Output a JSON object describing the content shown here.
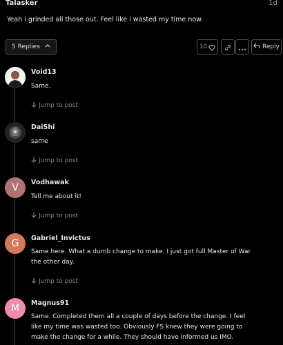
{
  "post": {
    "author": "Talasker",
    "age": "1d",
    "text": "Yeah i grinded all those out. Feel like i wasted my time now."
  },
  "actions": {
    "replies_label": "5 Replies",
    "like_count": "10",
    "reply_label": "Reply"
  },
  "jump_label": "Jump to post",
  "replies": [
    {
      "username": "Void13",
      "text": "Same.",
      "avatar_letter": "",
      "avatar_color": "#2a2a2a"
    },
    {
      "username": "DaiShi",
      "text": "same",
      "avatar_letter": "",
      "avatar_color": "#3a3a3a"
    },
    {
      "username": "Vodhawak",
      "text": "Tell me about it!",
      "avatar_letter": "V",
      "avatar_color": "#b07274"
    },
    {
      "username": "Gabriel_Invictus",
      "text": "Same here. What a dumb change to make. I just got full Master of War the other day.",
      "avatar_letter": "G",
      "avatar_color": "#d27a5b"
    },
    {
      "username": "Magnus91",
      "text": "Same. Completed them all a couple of days before the change. I feel like my time was wasted too. Obviously FS knew they were going to make the change for a while. They should have informed us IMO.",
      "avatar_letter": "M",
      "avatar_color": "#f08ab0"
    }
  ]
}
